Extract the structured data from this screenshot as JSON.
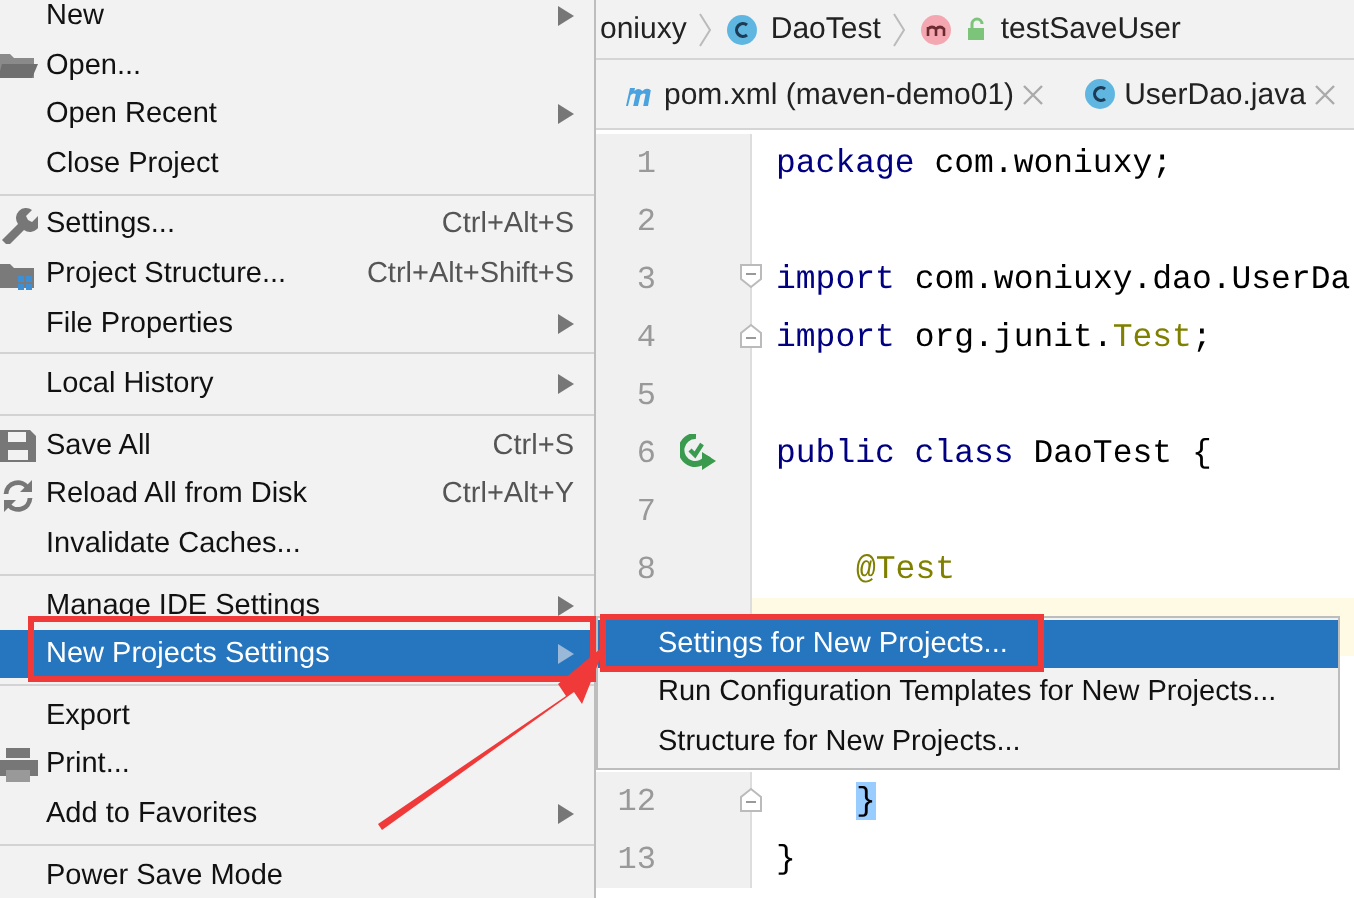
{
  "breadcrumb": [
    {
      "label": "oniuxy",
      "kind": "package"
    },
    {
      "label": "DaoTest",
      "kind": "class"
    },
    {
      "label": "testSaveUser",
      "kind": "method"
    }
  ],
  "tabs": [
    {
      "label": "pom.xml (maven-demo01)",
      "kind": "maven",
      "selected": false
    },
    {
      "label": "UserDao.java",
      "kind": "class",
      "selected": false
    }
  ],
  "code_lines": [
    {
      "number": "1",
      "current": false,
      "tokens": [
        {
          "kind": "keyword",
          "text": "package"
        },
        {
          "kind": "plain",
          "text": " com.woniuxy;"
        }
      ]
    },
    {
      "number": "2",
      "current": false
    },
    {
      "number": "3",
      "current": false,
      "tokens": [
        {
          "kind": "keyword",
          "text": "import"
        },
        {
          "kind": "plain",
          "text": " com.woniuxy.dao.UserDa"
        }
      ]
    },
    {
      "number": "4",
      "current": false,
      "tokens": [
        {
          "kind": "keyword",
          "text": "import"
        },
        {
          "kind": "plain",
          "text": " org.junit."
        },
        {
          "kind": "annotation",
          "text": "Test"
        },
        {
          "kind": "plain",
          "text": ";"
        }
      ]
    },
    {
      "number": "5",
      "current": false
    },
    {
      "number": "6",
      "current": false,
      "tokens": [
        {
          "kind": "keyword",
          "text": "public class"
        },
        {
          "kind": "plain",
          "text": " DaoTest {"
        }
      ]
    },
    {
      "number": "7",
      "current": false
    },
    {
      "number": "8",
      "current": false,
      "indented": true,
      "tokens": [
        {
          "kind": "annotation",
          "text": "@Test"
        }
      ]
    },
    {
      "current": true
    },
    {
      "number": "12",
      "current": false,
      "indented": true,
      "tokens": [
        {
          "kind": "brace-match",
          "text": "}"
        }
      ]
    },
    {
      "number": "13",
      "current": false,
      "tokens": [
        {
          "kind": "plain",
          "text": "}"
        }
      ]
    }
  ],
  "file_menu": [
    {
      "kind": "item",
      "label": "New",
      "submenu": true,
      "selected": false
    },
    {
      "kind": "item",
      "label": "Open...",
      "selected": false
    },
    {
      "kind": "item",
      "label": "Open Recent",
      "submenu": true,
      "selected": false
    },
    {
      "kind": "item",
      "label": "Close Project",
      "selected": false
    },
    {
      "kind": "separator"
    },
    {
      "kind": "item",
      "label": "Settings...",
      "shortcut": "Ctrl+Alt+S",
      "selected": false
    },
    {
      "kind": "item",
      "label": "Project Structure...",
      "shortcut": "Ctrl+Alt+Shift+S",
      "selected": false
    },
    {
      "kind": "item",
      "label": "File Properties",
      "submenu": true,
      "selected": false
    },
    {
      "kind": "separator"
    },
    {
      "kind": "item",
      "label": "Local History",
      "submenu": true,
      "selected": false
    },
    {
      "kind": "separator"
    },
    {
      "kind": "item",
      "label": "Save All",
      "shortcut": "Ctrl+S",
      "selected": false
    },
    {
      "kind": "item",
      "label": "Reload All from Disk",
      "shortcut": "Ctrl+Alt+Y",
      "selected": false
    },
    {
      "kind": "item",
      "label": "Invalidate Caches...",
      "selected": false
    },
    {
      "kind": "separator"
    },
    {
      "kind": "item",
      "label": "Manage IDE Settings",
      "submenu": true,
      "selected": false
    },
    {
      "kind": "item",
      "label": "New Projects Settings",
      "submenu": true,
      "selected": true
    },
    {
      "kind": "separator"
    },
    {
      "kind": "item",
      "label": "Export",
      "selected": false
    },
    {
      "kind": "item",
      "label": "Print...",
      "selected": false
    },
    {
      "kind": "item",
      "label": "Add to Favorites",
      "submenu": true,
      "selected": false
    },
    {
      "kind": "separator"
    },
    {
      "kind": "item",
      "label": "Power Save Mode",
      "selected": false
    }
  ],
  "submenu": [
    {
      "label": "Settings for New Projects...",
      "selected": true
    },
    {
      "label": "Run Configuration Templates for New Projects...",
      "selected": false
    },
    {
      "label": "Structure for New Projects...",
      "selected": false
    }
  ]
}
